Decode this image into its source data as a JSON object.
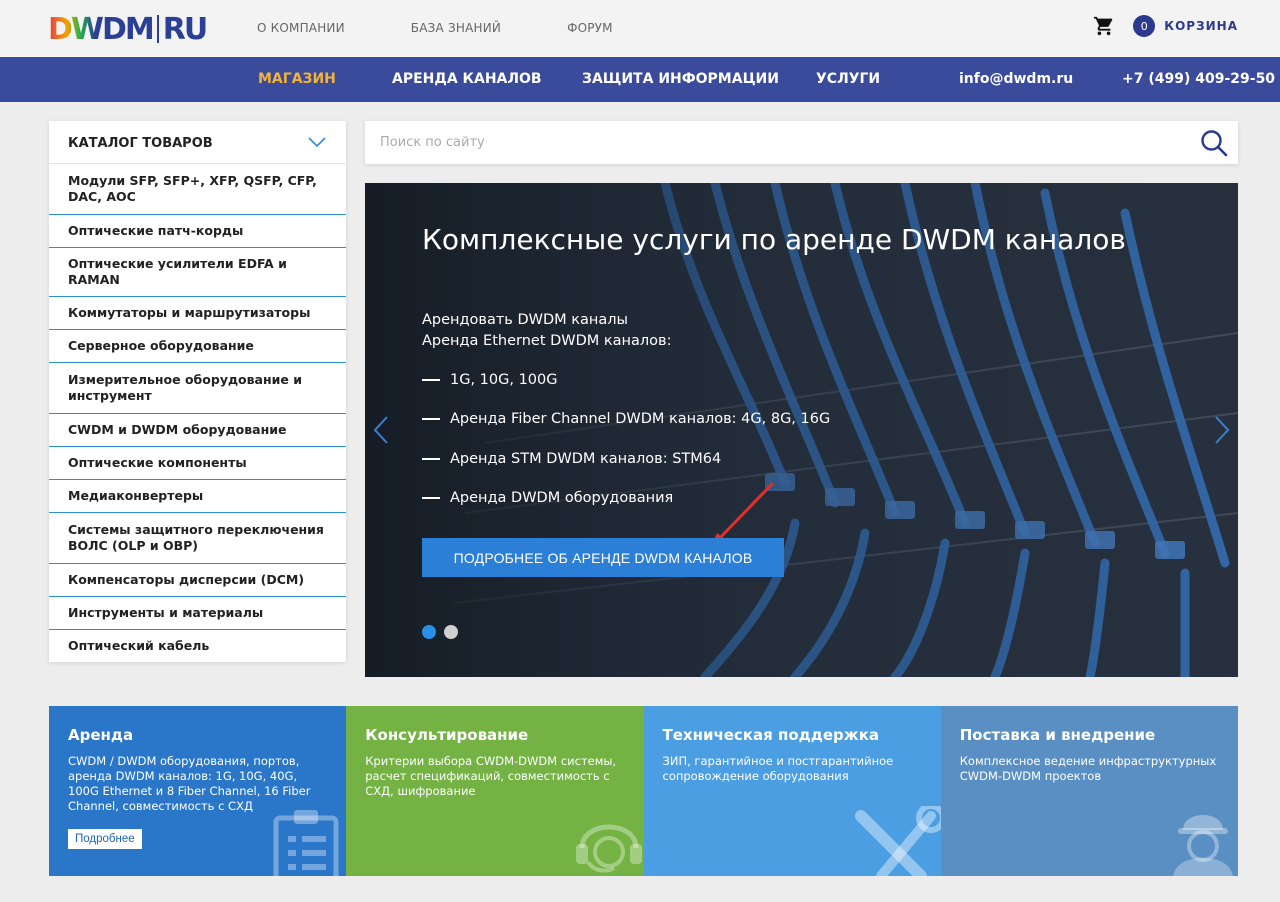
{
  "header": {
    "logo": {
      "left": "DWDM",
      "right": "RU"
    },
    "topnav": [
      "О КОМПАНИИ",
      "БАЗА ЗНАНИЙ",
      "ФОРУМ"
    ],
    "cart": {
      "count": "0",
      "label": "КОРЗИНА"
    }
  },
  "mainnav": {
    "items": [
      "МАГАЗИН",
      "АРЕНДА КАНАЛОВ",
      "ЗАЩИТА ИНФОРМАЦИИ",
      "УСЛУГИ"
    ],
    "email": "info@dwdm.ru",
    "phone": "+7 (499) 409-29-50"
  },
  "catalog": {
    "title": "КАТАЛОГ ТОВАРОВ",
    "items": [
      "Модули SFP, SFP+, XFP, QSFP, CFP, DAC, AOC",
      "Оптические патч-корды",
      "Оптические усилители EDFA и RAMAN",
      "Коммутаторы и маршрутизаторы",
      "Серверное оборудование",
      "Измерительное оборудование и инструмент",
      "CWDM и DWDM оборудование",
      "Оптические компоненты",
      "Медиаконвертеры",
      "Системы защитного переключения ВОЛС (OLP и OBP)",
      "Компенсаторы дисперсии (DCM)",
      "Инструменты и материалы",
      "Оптический кабель"
    ]
  },
  "search": {
    "placeholder": "Поиск по сайту"
  },
  "hero": {
    "title": "Комплексные услуги по аренде DWDM каналов",
    "lines": [
      "Арендовать DWDM каналы",
      "Аренда Ethernet DWDM каналов:"
    ],
    "bullets": [
      "1G, 10G, 100G",
      "Аренда Fiber Channel DWDM каналов: 4G, 8G, 16G",
      "Аренда STM DWDM каналов: STM64",
      "Аренда DWDM оборудования"
    ],
    "button": "ПОДРОБНЕЕ ОБ АРЕНДЕ DWDM КАНАЛОВ",
    "active_slide": 1,
    "slide_count": 2
  },
  "tiles": [
    {
      "title": "Аренда",
      "text": "CWDM / DWDM оборудования, портов, аренда DWDM каналов: 1G, 10G, 40G, 100G Ethernet и 8 Fiber Channel, 16 Fiber Channel, совместимость с СХД",
      "button": "Подробнее",
      "color": "#2a76c9",
      "icon": "clipboard-icon"
    },
    {
      "title": "Консультирование",
      "text": "Критерии выбора CWDM-DWDM системы, расчет спецификаций, совместимость с СХД, шифрование",
      "color": "#74b343",
      "icon": "headset-icon"
    },
    {
      "title": "Техническая поддержка",
      "text": "ЗИП, гарантийное и постгарантийное сопровождение оборудования",
      "color": "#4c9ee3",
      "icon": "tools-icon"
    },
    {
      "title": "Поставка и внедрение",
      "text": "Комплексное ведение инфраструктурных CWDM-DWDM проектов",
      "color": "#5a8fc3",
      "icon": "engineer-icon"
    }
  ],
  "colors": {
    "nav": "#3b4b9c",
    "accent": "#f0b23a",
    "button": "#2b7fd6",
    "catalog_border": "#2a8fd8"
  }
}
